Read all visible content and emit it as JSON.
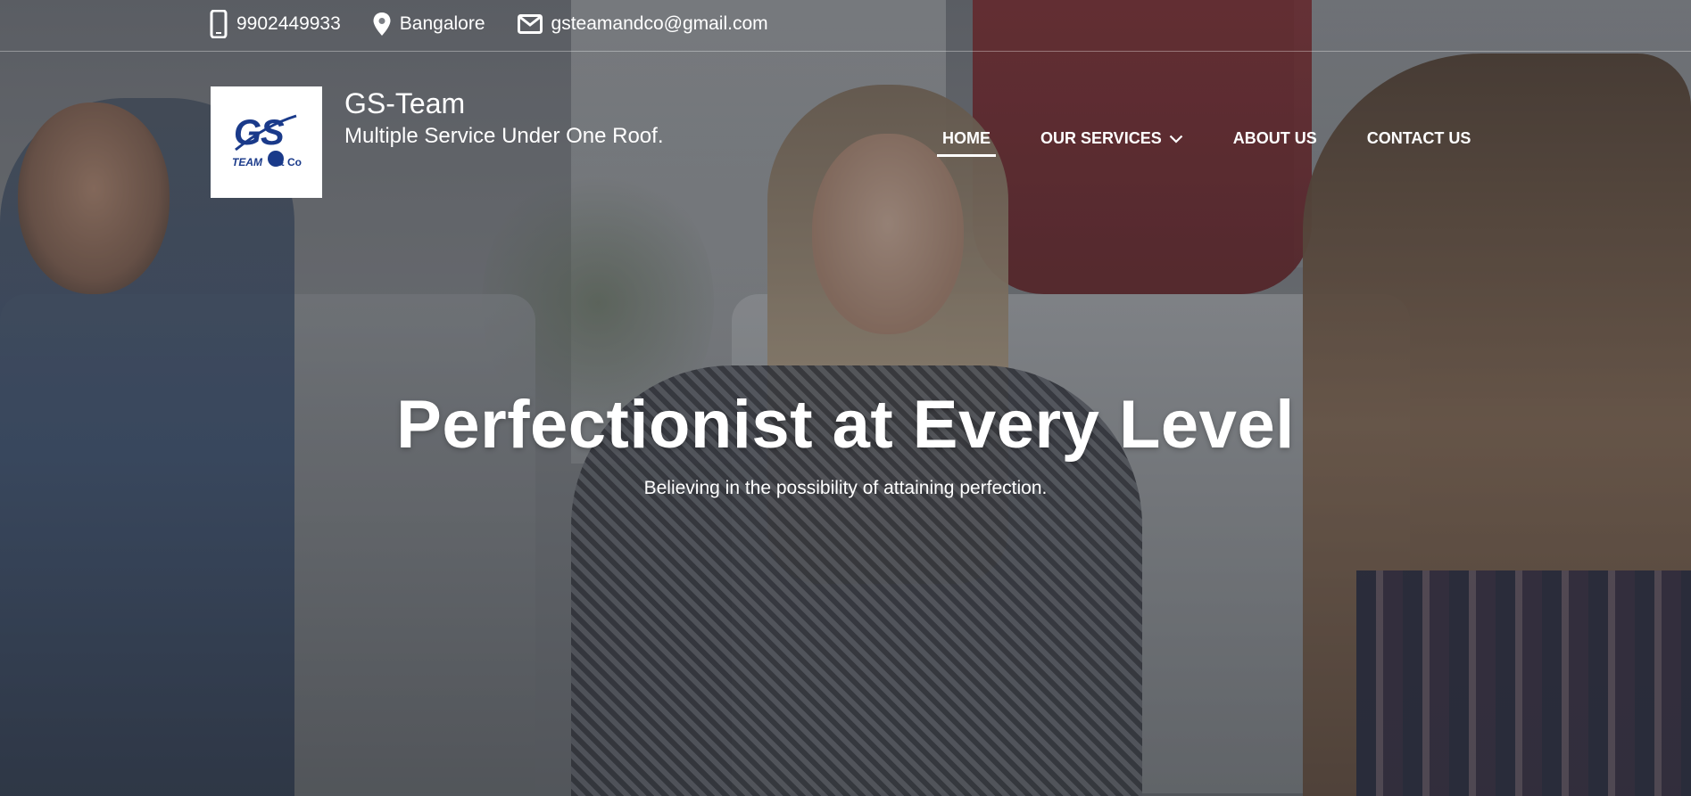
{
  "topbar": {
    "phone": "9902449933",
    "location": "Bangalore",
    "email": "gsteamandco@gmail.com"
  },
  "brand": {
    "title": "GS-Team",
    "tagline": "Multiple Service Under One Roof.",
    "logo_text_main": "GS",
    "logo_text_sub": "TEAM & Co",
    "logo_color": "#1a3a8a"
  },
  "nav": {
    "items": [
      {
        "label": "HOME",
        "active": true
      },
      {
        "label": "OUR SERVICES",
        "active": false,
        "has_dropdown": true
      },
      {
        "label": "ABOUT US",
        "active": false
      },
      {
        "label": "CONTACT US",
        "active": false
      }
    ]
  },
  "hero": {
    "heading": "Perfectionist at Every Level",
    "subheading": "Believing in the possibility of attaining perfection."
  },
  "icons": {
    "phone": "phone-icon",
    "location": "location-pin-icon",
    "email": "envelope-icon",
    "dropdown": "chevron-down-icon"
  }
}
